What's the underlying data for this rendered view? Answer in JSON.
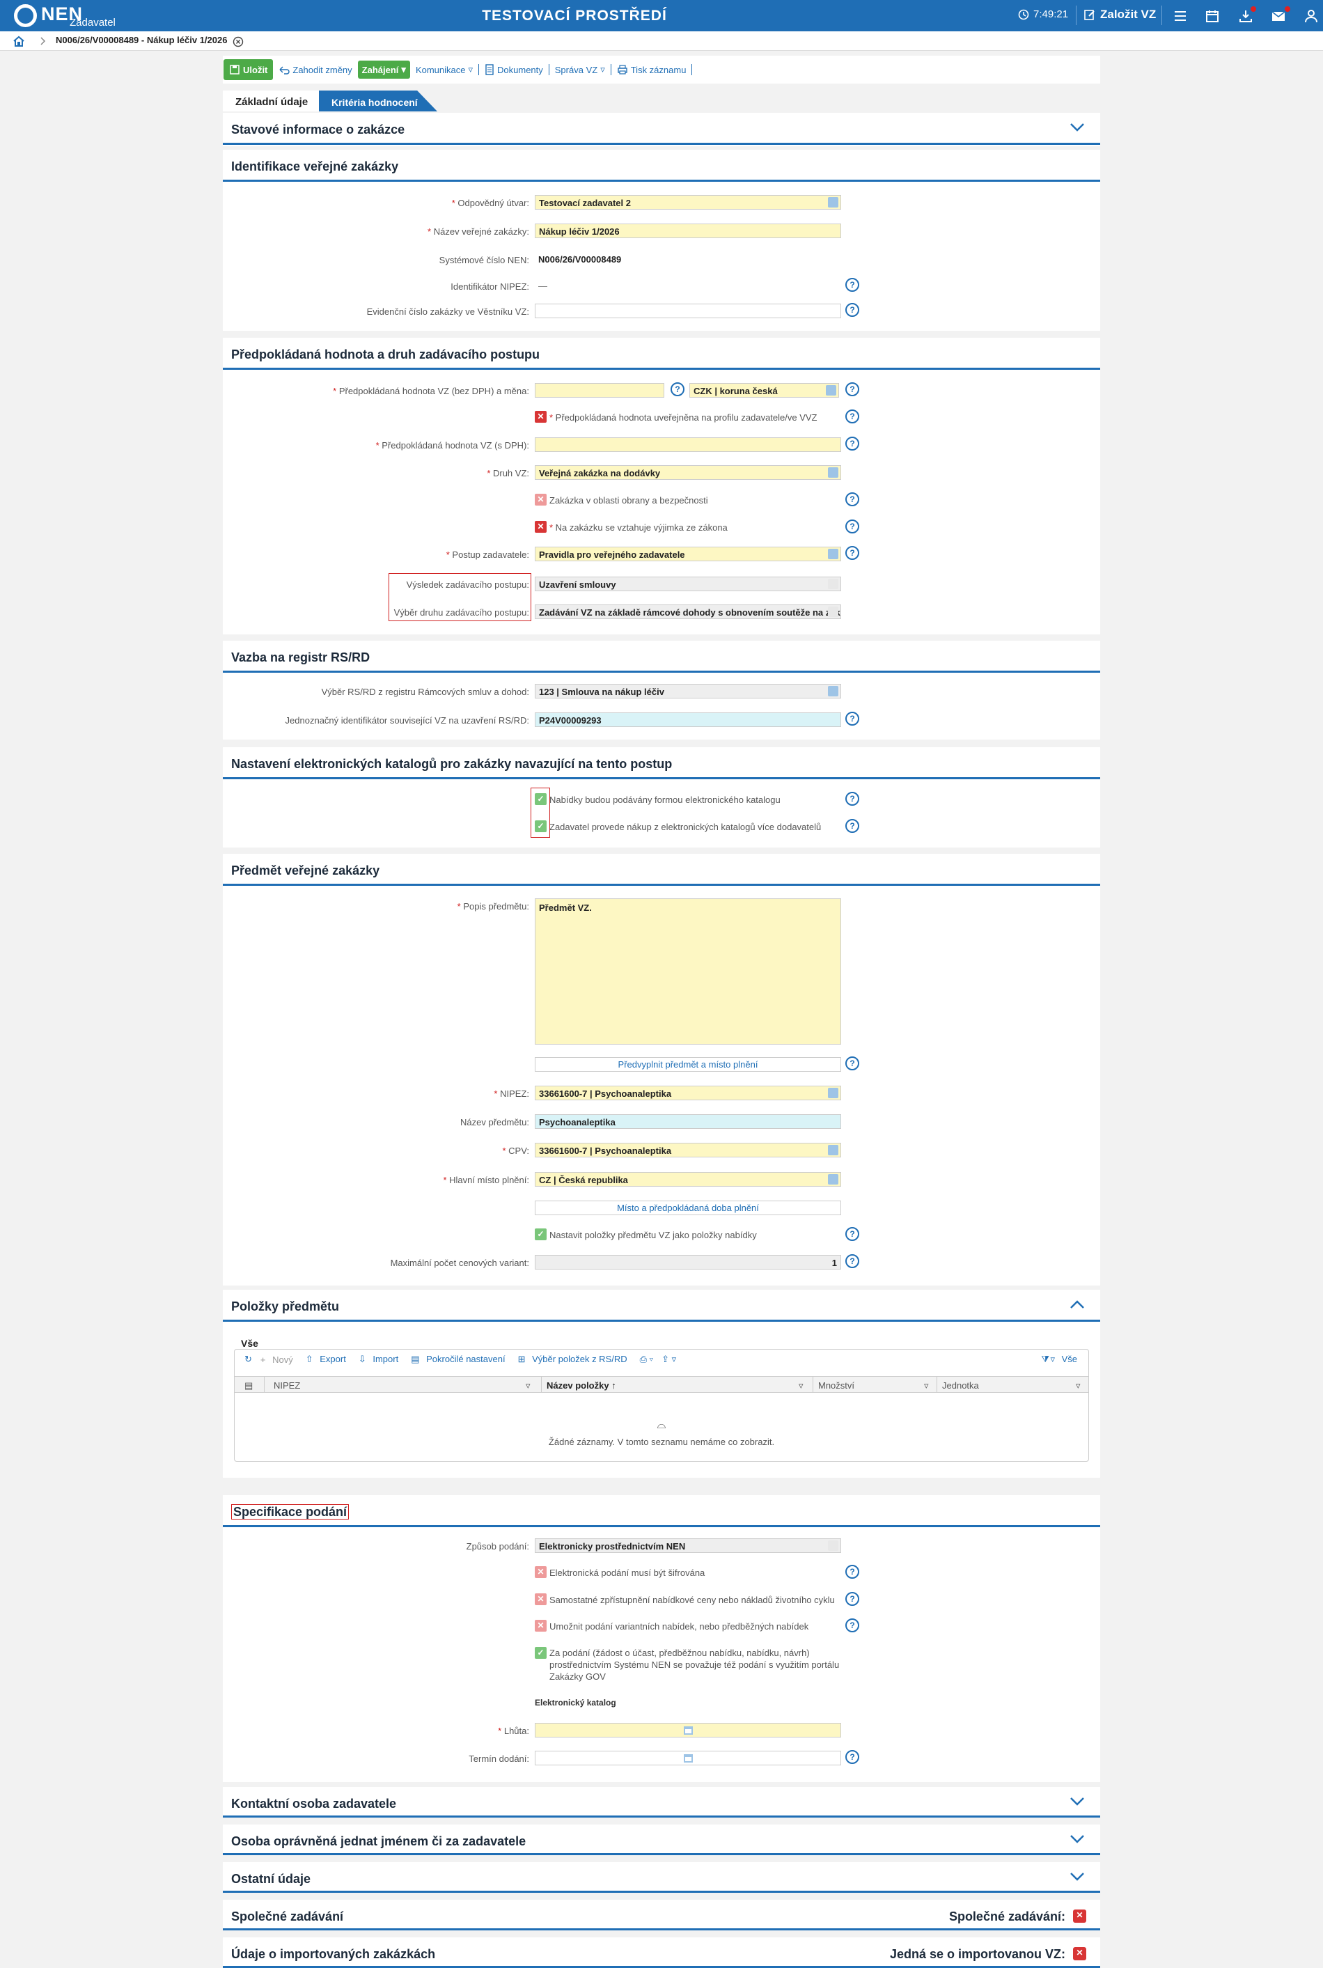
{
  "topbar": {
    "logo": "NEN",
    "logo_sub": "Zadavatel",
    "env": "TESTOVACÍ PROSTŘEDÍ",
    "time": "7:49:21",
    "new_label": "Založit VZ"
  },
  "breadcrumb": {
    "text": "N006/26/V00008489 - Nákup léčiv 1/2026"
  },
  "toolbar": {
    "save": "Uložit",
    "discard": "Zahodit změny",
    "start": "Zahájení",
    "communication": "Komunikace",
    "documents": "Dokumenty",
    "manage": "Správa VZ",
    "print": "Tisk záznamu"
  },
  "tabs": {
    "basic": "Základní údaje",
    "criteria": "Kritéria hodnocení"
  },
  "sections": {
    "status": "Stavové informace o zakázce",
    "ident": "Identifikace veřejné zakázky",
    "value": "Předpokládaná hodnota a druh zadávacího postupu",
    "registry": "Vazba na registr RS/RD",
    "catalog": "Nastavení elektronických katalogů pro zakázky navazující na tento postup",
    "subject": "Předmět veřejné zakázky",
    "items": "Položky předmětu",
    "spec": "Specifikace podání",
    "contact": "Kontaktní osoba zadavatele",
    "authorized": "Osoba oprávněná jednat jménem či za zadavatele",
    "other": "Ostatní údaje",
    "joint": "Společné zadávání",
    "imported": "Údaje o importovaných zakázkách"
  },
  "ident": {
    "unit_label": "Odpovědný útvar:",
    "unit_value": "Testovací zadavatel 2",
    "name_label": "Název veřejné zakázky:",
    "name_value": "Nákup léčiv 1/2026",
    "sysnum_label": "Systémové číslo NEN:",
    "sysnum_value": "N006/26/V00008489",
    "nipez_label": "Identifikátor NIPEZ:",
    "nipez_value": "—",
    "bulletin_label": "Evidenční číslo zakázky ve Věstníku VZ:"
  },
  "value": {
    "est_label": "Předpokládaná hodnota VZ (bez DPH) a měna:",
    "currency": "CZK | koruna česká",
    "published": "Předpokládaná hodnota uveřejněna na profilu zadavatele/ve VVZ",
    "vat_label": "Předpokládaná hodnota VZ (s DPH):",
    "type_label": "Druh VZ:",
    "type_value": "Veřejná zakázka na dodávky",
    "defense": "Zakázka v oblasti obrany a bezpečnosti",
    "exception": "Na zakázku se vztahuje výjimka ze zákona",
    "proc_label": "Postup zadavatele:",
    "proc_value": "Pravidla pro veřejného zadavatele",
    "result_label": "Výsledek zadávacího postupu:",
    "result_value": "Uzavření smlouvy",
    "kind_label": "Výběr druhu zadávacího postupu:",
    "kind_value": "Zadávání VZ na základě rámcové dohody s obnovením soutěže na zákla"
  },
  "registry": {
    "sel_label": "Výběr RS/RD z registru Rámcových smluv a dohod:",
    "sel_value": "123 | Smlouva na nákup léčiv",
    "id_label": "Jednoznačný identifikátor související VZ na uzavření RS/RD:",
    "id_value": "P24V00009293"
  },
  "catalog": {
    "offers": "Nabídky budou podávány formou elektronického katalogu",
    "purchase": "Zadavatel provede nákup z elektronických katalogů více dodavatelů"
  },
  "subject": {
    "desc_label": "Popis předmětu:",
    "desc_value": "Předmět VZ.",
    "prefill": "Předvyplnit předmět a místo plnění",
    "nipez_label": "NIPEZ:",
    "nipez_value": "33661600-7 | Psychoanaleptika",
    "subjname_label": "Název předmětu:",
    "subjname_value": "Psychoanaleptika",
    "cpv_label": "CPV:",
    "cpv_value": "33661600-7 | Psychoanaleptika",
    "place_label": "Hlavní místo plnění:",
    "place_value": "CZ | Česká republika",
    "place_btn": "Místo a předpokládaná doba plnění",
    "set_items": "Nastavit položky předmětu VZ jako položky nabídky",
    "max_label": "Maximální počet cenových variant:",
    "max_value": "1"
  },
  "items": {
    "subtab": "Vše",
    "new": "Nový",
    "export": "Export",
    "import": "Import",
    "advanced": "Pokročilé nastavení",
    "pick": "Výběr položek z RS/RD",
    "all": "Vše",
    "cols": [
      "NIPEZ",
      "Název položky",
      "Množství",
      "Jednotka"
    ],
    "empty": "Žádné záznamy. V tomto seznamu nemáme co zobrazit."
  },
  "spec": {
    "mode_label": "Způsob podání:",
    "mode_value": "Elektronicky prostřednictvím NEN",
    "encrypted": "Elektronická podání musí být šifrována",
    "separate": "Samostatné zpřístupnění nabídkové ceny nebo nákladů životního cyklu",
    "variants": "Umožnit podání variantních nabídek, nebo předběžných nabídek",
    "gov_1": "Za podání (žádost o účast, předběžnou nabídku, nabídku, návrh)",
    "gov_2": "prostřednictvím Systému NEN se považuje též podání s využitím portálu",
    "gov_3": "Zakázky GOV",
    "catalog_head": "Elektronický katalog",
    "deadline_label": "Lhůta:",
    "delivery_label": "Termín dodání:"
  },
  "bottom": {
    "joint_right": "Společné zadávání:",
    "imported_right": "Jedná se o importovanou VZ:"
  }
}
